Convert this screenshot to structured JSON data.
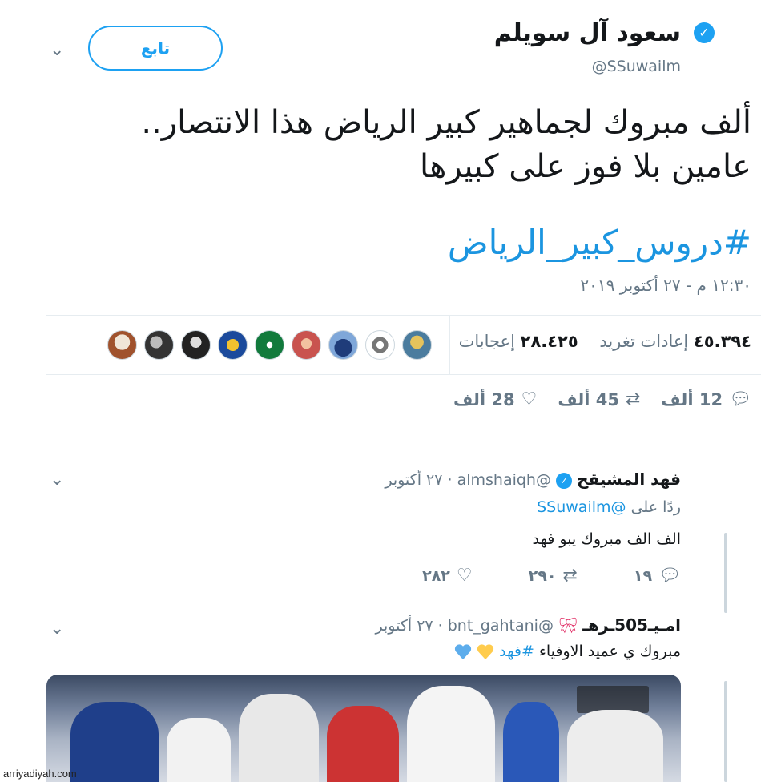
{
  "author": {
    "name": "سعود آل سويلم",
    "handle": "@SSuwailm",
    "follow_label": "تابع"
  },
  "tweet": {
    "text_line1": "ألف مبروك لجماهير كبير الرياض هذا الانتصار..",
    "text_line2": "عامين بلا فوز على كبيرها",
    "hashtag": "#دروس_كبير_الرياض",
    "timestamp": "١٢:٣٠ م - ٢٧ أكتوبر ٢٠١٩"
  },
  "stats": {
    "retweets_count": "٤٥.٣٩٤",
    "retweets_label": "إعادات تغريد",
    "likes_count": "٢٨.٤٢٥",
    "likes_label": "إعجابات"
  },
  "actions": {
    "replies": "12 ألف",
    "retweets": "45 ألف",
    "likes": "28 ألف"
  },
  "replies": [
    {
      "name": "فهد المشيقح",
      "handle": "@almshaiqh",
      "date": "٢٧ أكتوبر",
      "replying_prefix": "ردًا على",
      "replying_to": "@SSuwailm",
      "text": "الف الف مبروك يبو فهد",
      "reply_count": "١٩",
      "retweet_count": "٢٩٠",
      "like_count": "٢٨٢"
    },
    {
      "name": "امـيـ505ـرهـ",
      "handle": "@bnt_gahtani",
      "date": "٢٧ أكتوبر",
      "text_prefix": "مبروك ي عميد الاوفياء",
      "text_hashtag": "#فهد"
    }
  ],
  "watermark": "arriyadiyah.com",
  "colors": {
    "accent": "#1da1f2",
    "link": "#1b95e0",
    "muted": "#657786"
  }
}
